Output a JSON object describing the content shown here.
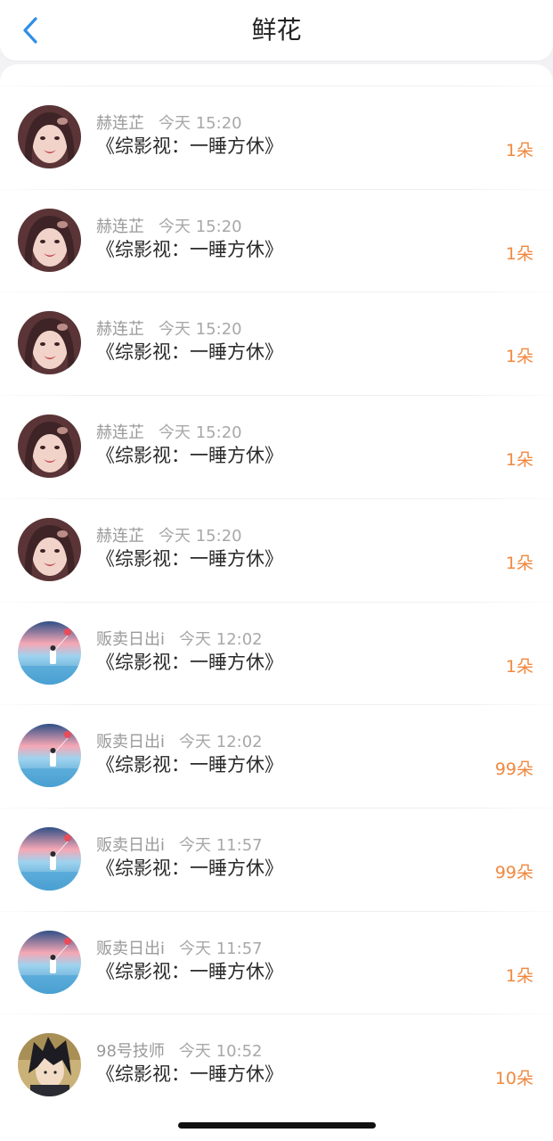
{
  "header": {
    "title": "鲜花",
    "back_icon": "chevron-left-icon"
  },
  "colors": {
    "accent": "#f0883f",
    "back": "#2f8fe6"
  },
  "items": [
    {
      "name": "赫连芷",
      "time": "今天 15:20",
      "title": "《综影视：一睡方休》",
      "count": "1朵",
      "avatar": "portrait-girl"
    },
    {
      "name": "赫连芷",
      "time": "今天 15:20",
      "title": "《综影视：一睡方休》",
      "count": "1朵",
      "avatar": "portrait-girl"
    },
    {
      "name": "赫连芷",
      "time": "今天 15:20",
      "title": "《综影视：一睡方休》",
      "count": "1朵",
      "avatar": "portrait-girl"
    },
    {
      "name": "赫连芷",
      "time": "今天 15:20",
      "title": "《综影视：一睡方休》",
      "count": "1朵",
      "avatar": "portrait-girl"
    },
    {
      "name": "赫连芷",
      "time": "今天 15:20",
      "title": "《综影视：一睡方休》",
      "count": "1朵",
      "avatar": "portrait-girl"
    },
    {
      "name": "贩卖日出i",
      "time": "今天 12:02",
      "title": "《综影视：一睡方休》",
      "count": "1朵",
      "avatar": "sky-scene"
    },
    {
      "name": "贩卖日出i",
      "time": "今天 12:02",
      "title": "《综影视：一睡方休》",
      "count": "99朵",
      "avatar": "sky-scene"
    },
    {
      "name": "贩卖日出i",
      "time": "今天 11:57",
      "title": "《综影视：一睡方休》",
      "count": "99朵",
      "avatar": "sky-scene"
    },
    {
      "name": "贩卖日出i",
      "time": "今天 11:57",
      "title": "《综影视：一睡方休》",
      "count": "1朵",
      "avatar": "sky-scene"
    },
    {
      "name": "98号技师",
      "time": "今天 10:52",
      "title": "《综影视：一睡方休》",
      "count": "10朵",
      "avatar": "anime-boy"
    }
  ]
}
